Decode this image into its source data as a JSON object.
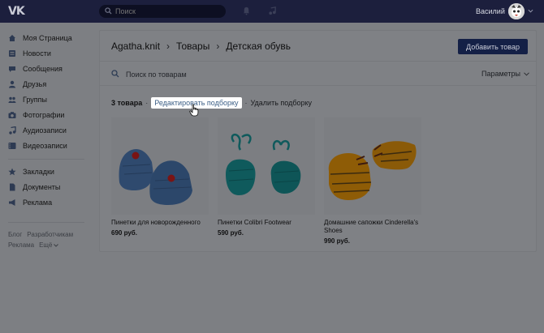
{
  "header": {
    "logo": "VK",
    "search_placeholder": "Поиск",
    "user_name": "Василий"
  },
  "sidebar": {
    "items": [
      {
        "label": "Моя Страница",
        "icon": "home-icon"
      },
      {
        "label": "Новости",
        "icon": "news-icon"
      },
      {
        "label": "Сообщения",
        "icon": "messages-icon"
      },
      {
        "label": "Друзья",
        "icon": "friend-icon"
      },
      {
        "label": "Группы",
        "icon": "groups-icon"
      },
      {
        "label": "Фотографии",
        "icon": "camera-icon"
      },
      {
        "label": "Аудиозаписи",
        "icon": "music-icon"
      },
      {
        "label": "Видеозаписи",
        "icon": "video-icon"
      },
      {
        "label": "Закладки",
        "icon": "star-icon"
      },
      {
        "label": "Документы",
        "icon": "document-icon"
      },
      {
        "label": "Реклама",
        "icon": "megaphone-icon"
      }
    ],
    "footer": {
      "blog": "Блог",
      "developers": "Разработчикам",
      "ads": "Реклама",
      "more": "Ещё"
    }
  },
  "main": {
    "breadcrumb": [
      "Agatha.knit",
      "Товары",
      "Детская обувь"
    ],
    "add_button": "Добавить товар",
    "search_placeholder": "Поиск по товарам",
    "params_label": "Параметры",
    "count_label": "3 товара",
    "edit_link": "Редактировать подборку",
    "delete_link": "Удалить подборку",
    "products": [
      {
        "name": "Пинетки для новорожденного",
        "price": "690 руб."
      },
      {
        "name": "Пинетки Colibri Footwear",
        "price": "590 руб."
      },
      {
        "name": "Домашние сапожки Cinderella's Shoes",
        "price": "990 руб."
      }
    ]
  },
  "colors": {
    "header_bg": "#1c1f3d",
    "overlay_bg": "#7d7f83",
    "button_bg": "#142046",
    "link_color": "#3b5e86"
  }
}
